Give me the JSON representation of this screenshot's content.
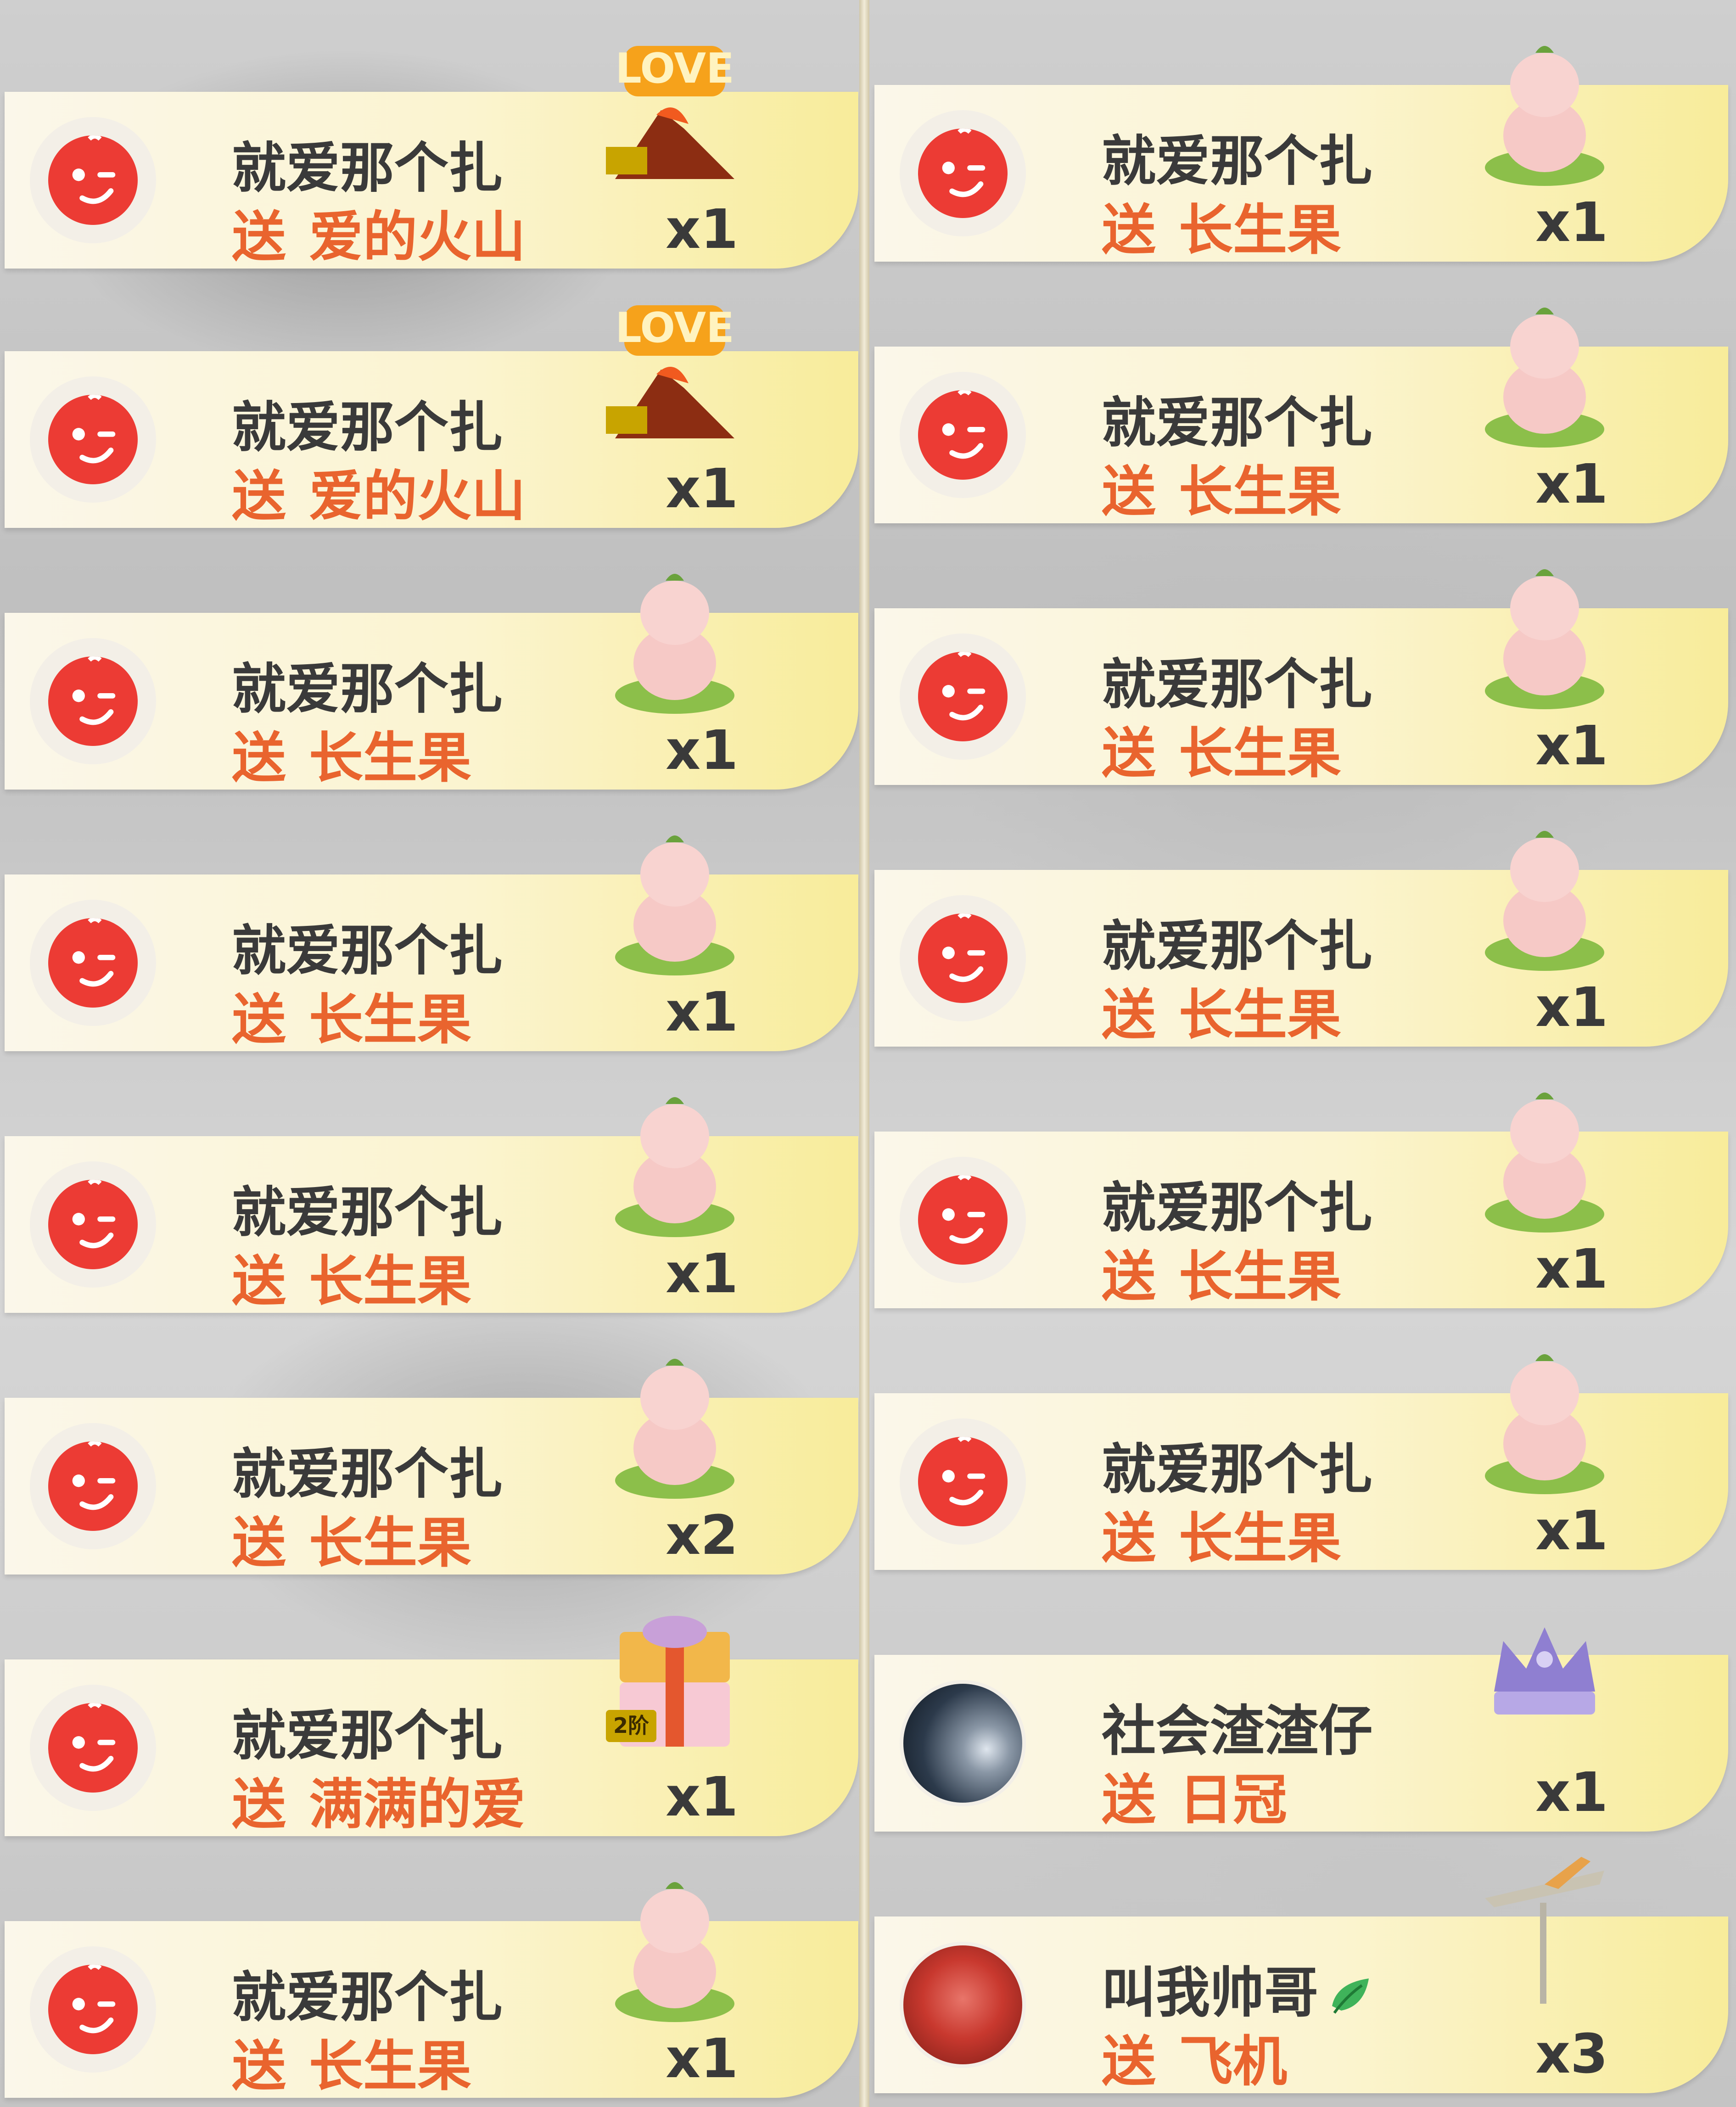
{
  "left_column": [
    {
      "user": "就爱那个扎",
      "verb": "送",
      "gift": "爱的火山",
      "count": "x1",
      "avatar": "red-face",
      "gift_icon": "love-volcano-icon",
      "badge": ""
    },
    {
      "user": "就爱那个扎",
      "verb": "送",
      "gift": "爱的火山",
      "count": "x1",
      "avatar": "red-face",
      "gift_icon": "love-volcano-icon",
      "badge": ""
    },
    {
      "user": "就爱那个扎",
      "verb": "送",
      "gift": "长生果",
      "count": "x1",
      "avatar": "red-face",
      "gift_icon": "peach-icon",
      "badge": ""
    },
    {
      "user": "就爱那个扎",
      "verb": "送",
      "gift": "长生果",
      "count": "x1",
      "avatar": "red-face",
      "gift_icon": "peach-icon",
      "badge": ""
    },
    {
      "user": "就爱那个扎",
      "verb": "送",
      "gift": "长生果",
      "count": "x1",
      "avatar": "red-face",
      "gift_icon": "peach-icon",
      "badge": ""
    },
    {
      "user": "就爱那个扎",
      "verb": "送",
      "gift": "长生果",
      "count": "x2",
      "avatar": "red-face",
      "gift_icon": "peach-icon",
      "badge": ""
    },
    {
      "user": "就爱那个扎",
      "verb": "送",
      "gift": "满满的爱",
      "count": "x1",
      "avatar": "red-face",
      "gift_icon": "gift-box-icon",
      "badge": "2阶"
    },
    {
      "user": "就爱那个扎",
      "verb": "送",
      "gift": "长生果",
      "count": "x1",
      "avatar": "red-face",
      "gift_icon": "peach-icon",
      "badge": ""
    }
  ],
  "right_column": [
    {
      "user": "就爱那个扎",
      "verb": "送",
      "gift": "长生果",
      "count": "x1",
      "avatar": "red-face",
      "gift_icon": "peach-icon",
      "badge": ""
    },
    {
      "user": "就爱那个扎",
      "verb": "送",
      "gift": "长生果",
      "count": "x1",
      "avatar": "red-face",
      "gift_icon": "peach-icon",
      "badge": ""
    },
    {
      "user": "就爱那个扎",
      "verb": "送",
      "gift": "长生果",
      "count": "x1",
      "avatar": "red-face",
      "gift_icon": "peach-icon",
      "badge": ""
    },
    {
      "user": "就爱那个扎",
      "verb": "送",
      "gift": "长生果",
      "count": "x1",
      "avatar": "red-face",
      "gift_icon": "peach-icon",
      "badge": ""
    },
    {
      "user": "就爱那个扎",
      "verb": "送",
      "gift": "长生果",
      "count": "x1",
      "avatar": "red-face",
      "gift_icon": "peach-icon",
      "badge": ""
    },
    {
      "user": "就爱那个扎",
      "verb": "送",
      "gift": "长生果",
      "count": "x1",
      "avatar": "red-face",
      "gift_icon": "peach-icon",
      "badge": ""
    },
    {
      "user": "社会渣渣仔",
      "verb": "送",
      "gift": "日冠",
      "count": "x1",
      "avatar": "sky-photo",
      "gift_icon": "crown-icon",
      "badge": ""
    },
    {
      "user": "叫我帅哥",
      "verb": "送",
      "gift": "飞机",
      "count": "x3",
      "avatar": "red-photo",
      "gift_icon": "airplane-icon",
      "badge": "",
      "user_badge_icon": "leaf-icon"
    }
  ],
  "colors": {
    "username": "#3a3a3a",
    "gift_text": "#e9642e",
    "avatar_red": "#ec3b34",
    "card_start": "#fbf7ea",
    "card_end": "#f8ec9a"
  }
}
